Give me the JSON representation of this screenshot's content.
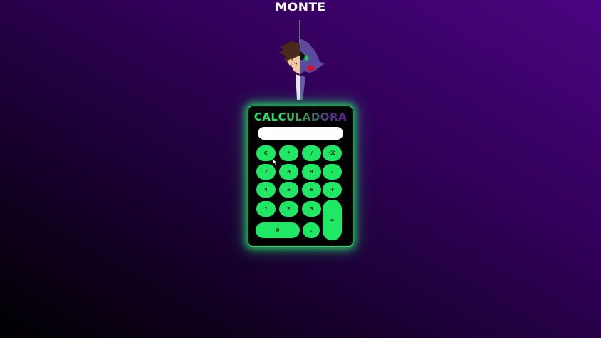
{
  "header": {
    "brand": "MONTE"
  },
  "calculator": {
    "title": "CALCULADORA",
    "display": {
      "value": "",
      "placeholder": ""
    },
    "keys": [
      {
        "id": "key-clear",
        "label": "C"
      },
      {
        "id": "key-multiply",
        "label": "*"
      },
      {
        "id": "key-divide",
        "label": "/"
      },
      {
        "id": "key-backspace",
        "label": "⌫"
      },
      {
        "id": "key-7",
        "label": "7"
      },
      {
        "id": "key-8",
        "label": "8"
      },
      {
        "id": "key-9",
        "label": "9"
      },
      {
        "id": "key-minus",
        "label": "-"
      },
      {
        "id": "key-4",
        "label": "4"
      },
      {
        "id": "key-5",
        "label": "5"
      },
      {
        "id": "key-6",
        "label": "6"
      },
      {
        "id": "key-plus",
        "label": "+"
      },
      {
        "id": "key-1",
        "label": "1"
      },
      {
        "id": "key-2",
        "label": "2"
      },
      {
        "id": "key-3",
        "label": "3"
      },
      {
        "id": "key-equals",
        "label": "="
      },
      {
        "id": "key-0",
        "label": "0"
      },
      {
        "id": "key-decimal",
        "label": "."
      }
    ]
  },
  "colors": {
    "accent": "#1ee864",
    "background_top": "#4a0580",
    "background_bottom": "#000000",
    "display": "#ffffff"
  }
}
